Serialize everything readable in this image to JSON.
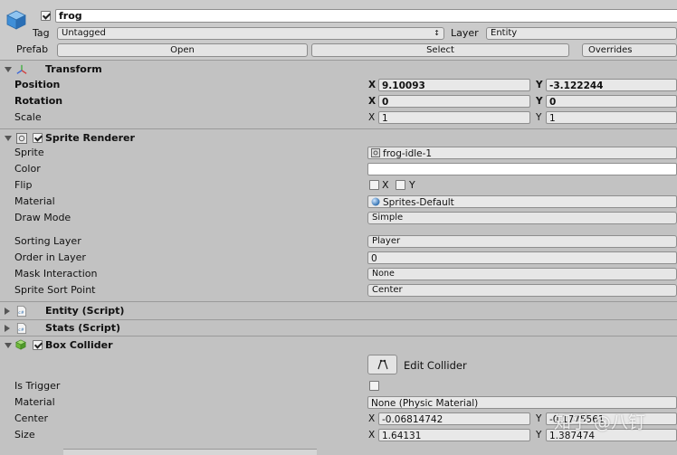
{
  "object": {
    "name": "frog",
    "tag_label": "Tag",
    "tag_value": "Untagged",
    "layer_label": "Layer",
    "layer_value": "Entity",
    "prefab_label": "Prefab",
    "open_label": "Open",
    "select_label": "Select",
    "overrides_label": "Overrides"
  },
  "transform": {
    "title": "Transform",
    "position_label": "Position",
    "rotation_label": "Rotation",
    "scale_label": "Scale",
    "x_axis": "X",
    "y_axis": "Y",
    "position_x": "9.10093",
    "position_y": "-3.122244",
    "rotation_x": "0",
    "rotation_y": "0",
    "scale_x": "1",
    "scale_y": "1"
  },
  "sprite_renderer": {
    "title": "Sprite Renderer",
    "sprite_label": "Sprite",
    "sprite_value": "frog-idle-1",
    "color_label": "Color",
    "flip_label": "Flip",
    "flip_x": "X",
    "flip_y": "Y",
    "material_label": "Material",
    "material_value": "Sprites-Default",
    "draw_mode_label": "Draw Mode",
    "draw_mode_value": "Simple",
    "sorting_layer_label": "Sorting Layer",
    "sorting_layer_value": "Player",
    "order_label": "Order in Layer",
    "order_value": "0",
    "mask_label": "Mask Interaction",
    "mask_value": "None",
    "sort_point_label": "Sprite Sort Point",
    "sort_point_value": "Center"
  },
  "entity_script": {
    "title": "Entity (Script)"
  },
  "stats_script": {
    "title": "Stats (Script)"
  },
  "box_collider": {
    "title": "Box Collider",
    "edit_label": "Edit Collider",
    "trigger_label": "Is Trigger",
    "material_label": "Material",
    "material_value": "None (Physic Material)",
    "center_label": "Center",
    "size_label": "Size",
    "center_x": "-0.06814742",
    "center_y": "-0.1775561",
    "size_x": "1.64131",
    "size_y": "1.387474"
  },
  "watermark": "知乎 @八钉",
  "colors": {
    "panel": "#c2c2c2",
    "header": "#c8c8c8",
    "field": "#e8e8e8",
    "cube_blue": "#3f8fd8",
    "collider_green": "#6fb83a"
  }
}
